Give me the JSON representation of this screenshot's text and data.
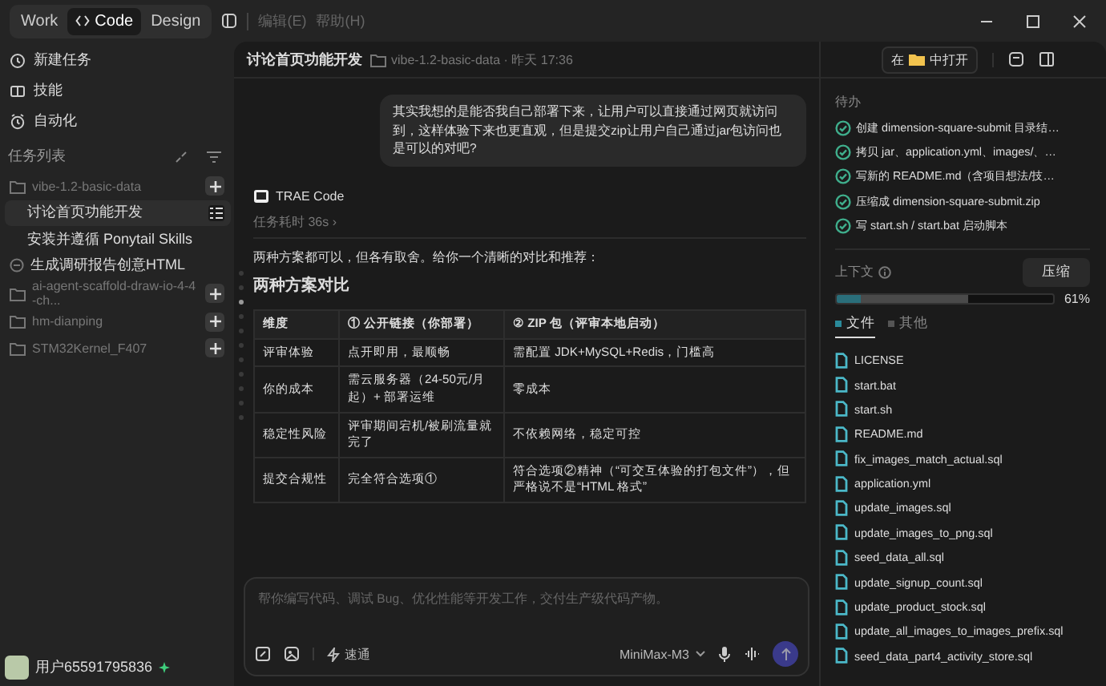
{
  "topbar": {
    "modes": [
      {
        "label": "Work",
        "selected": false
      },
      {
        "label": "Code",
        "selected": true
      },
      {
        "label": "Design",
        "selected": false
      }
    ],
    "menu": [
      "编辑(E)",
      "帮助(H)"
    ]
  },
  "sidebar": {
    "actions": [
      {
        "label": "新建任务",
        "kind": "new"
      },
      {
        "label": "技能",
        "kind": "skills"
      },
      {
        "label": "自动化",
        "kind": "auto"
      }
    ],
    "section_title": "任务列表",
    "tasks": [
      {
        "kind": "folder",
        "label": "vibe-1.2-basic-data",
        "children": [
          {
            "kind": "task",
            "label": "讨论首页功能开发",
            "selected": true
          },
          {
            "kind": "task",
            "label": "安装并遵循 Ponytail Skills",
            "selected": false
          }
        ]
      },
      {
        "kind": "standalone",
        "label": "生成调研报告创意HTML",
        "selected": false
      },
      {
        "kind": "folder",
        "label": "ai-agent-scaffold-draw-io-4-4-ch..."
      },
      {
        "kind": "folder",
        "label": "hm-dianping"
      },
      {
        "kind": "folder",
        "label": "STM32Kernel_F407"
      }
    ],
    "user": "用户65591795836"
  },
  "chat": {
    "title": "讨论首页功能开发",
    "meta": "vibe-1.2-basic-data · 昨天 17:36",
    "user_message": "其实我想的是能否我自己部署下来，让用户可以直接通过网页就访问到，这样体验下来也更直观，但是提交zip让用户自己通过jar包访问也是可以的对吧?",
    "agent": "TRAE Code",
    "duration": "任务耗时 36s ›",
    "intro": "两种方案都可以，但各有取舍。给你一个清晰的对比和推荐：",
    "heading": "两种方案对比",
    "table": {
      "columns": [
        "维度",
        "① 公开链接（你部署）",
        "② ZIP 包（评审本地启动）"
      ],
      "rows": [
        [
          "评审体验",
          "点开即用，最顺畅",
          "需配置 JDK+MySQL+Redis，门槛高"
        ],
        [
          "你的成本",
          "需云服务器（24-50元/月起）+ 部署运维",
          "零成本"
        ],
        [
          "稳定性风险",
          "评审期间宕机/被刷流量就完了",
          "不依赖网络，稳定可控"
        ],
        [
          "提交合规性",
          "完全符合选项①",
          "符合选项②精神（“可交互体验的打包文件”），但严格说不是“HTML 格式”"
        ]
      ]
    }
  },
  "composer": {
    "placeholder": "帮你编写代码、调试 Bug、优化性能等开发工作，交付生产级代码产物。",
    "mode": "速通",
    "model": "MiniMax-M3"
  },
  "panel": {
    "open_prefix": "在",
    "open_suffix": "中打开",
    "todo_title": "待办",
    "todos": [
      {
        "label": "创建 dimension-square-submit 目录结…",
        "done": true
      },
      {
        "label": "拷贝 jar、application.yml、images/、…",
        "done": true
      },
      {
        "label": "写新的 README.md（含项目想法/技…",
        "done": true
      },
      {
        "label": "压缩成 dimension-square-submit.zip",
        "done": true
      },
      {
        "label": "写 start.sh / start.bat 启动脚本",
        "done": true
      }
    ],
    "context": {
      "label": "上下文",
      "level": 0.61,
      "reading": "61%",
      "compress": "压缩"
    },
    "tabs": [
      {
        "label": "文件",
        "selected": true
      },
      {
        "label": "其他",
        "selected": false
      }
    ],
    "files": [
      "LICENSE",
      "start.bat",
      "start.sh",
      "README.md",
      "fix_images_match_actual.sql",
      "application.yml",
      "update_images.sql",
      "update_images_to_png.sql",
      "seed_data_all.sql",
      "update_signup_count.sql",
      "update_product_stock.sql",
      "update_all_images_to_images_prefix.sql",
      "seed_data_part4_activity_store.sql"
    ]
  }
}
